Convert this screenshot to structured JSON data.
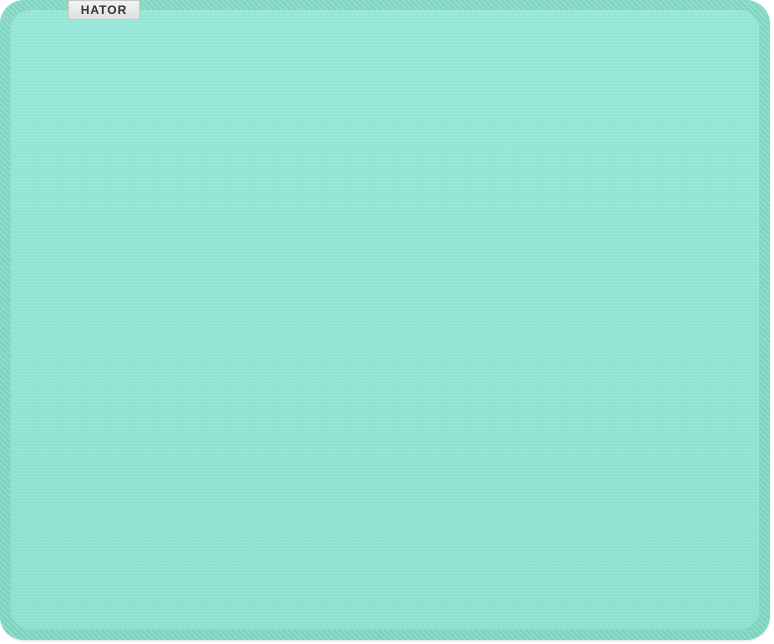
{
  "product": {
    "brand_label": "HATOR",
    "surface_color": "#94e8d7",
    "edge_color": "#84dbc6"
  }
}
